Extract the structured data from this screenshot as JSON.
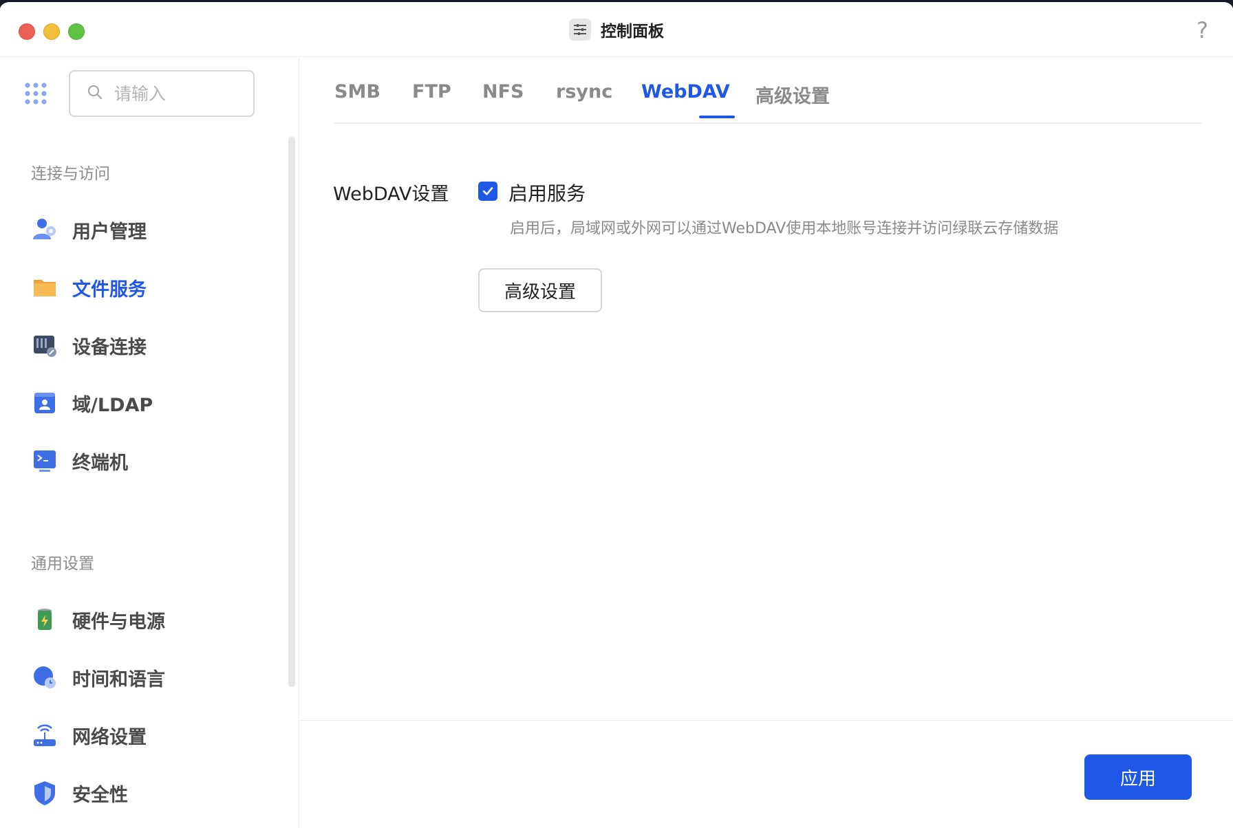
{
  "window": {
    "title": "控制面板",
    "help": "?"
  },
  "sidebar": {
    "search_placeholder": "请输入",
    "sections": [
      {
        "label": "连接与访问",
        "items": [
          {
            "label": "用户管理",
            "icon": "user-management-icon",
            "active": false
          },
          {
            "label": "文件服务",
            "icon": "folder-icon",
            "active": true
          },
          {
            "label": "设备连接",
            "icon": "device-connection-icon",
            "active": false
          },
          {
            "label": "域/LDAP",
            "icon": "ldap-icon",
            "active": false
          },
          {
            "label": "终端机",
            "icon": "terminal-icon",
            "active": false
          }
        ]
      },
      {
        "label": "通用设置",
        "items": [
          {
            "label": "硬件与电源",
            "icon": "battery-icon",
            "active": false
          },
          {
            "label": "时间和语言",
            "icon": "globe-clock-icon",
            "active": false
          },
          {
            "label": "网络设置",
            "icon": "router-icon",
            "active": false
          },
          {
            "label": "安全性",
            "icon": "shield-icon",
            "active": false
          }
        ]
      }
    ]
  },
  "main": {
    "tabs": [
      {
        "label": "SMB",
        "active": false
      },
      {
        "label": "FTP",
        "active": false
      },
      {
        "label": "NFS",
        "active": false
      },
      {
        "label": "rsync",
        "active": false
      },
      {
        "label": "WebDAV",
        "active": true
      },
      {
        "label": "高级设置",
        "active": false
      }
    ],
    "setting": {
      "label": "WebDAV设置",
      "checkbox_label": "启用服务",
      "checked": true,
      "description": "启用后，局域网或外网可以通过WebDAV使用本地账号连接并访问绿联云存储数据",
      "advanced_button": "高级设置"
    },
    "apply_button": "应用"
  },
  "colors": {
    "accent": "#1f57e6",
    "text": "#222222",
    "muted": "#8a8a8a"
  }
}
